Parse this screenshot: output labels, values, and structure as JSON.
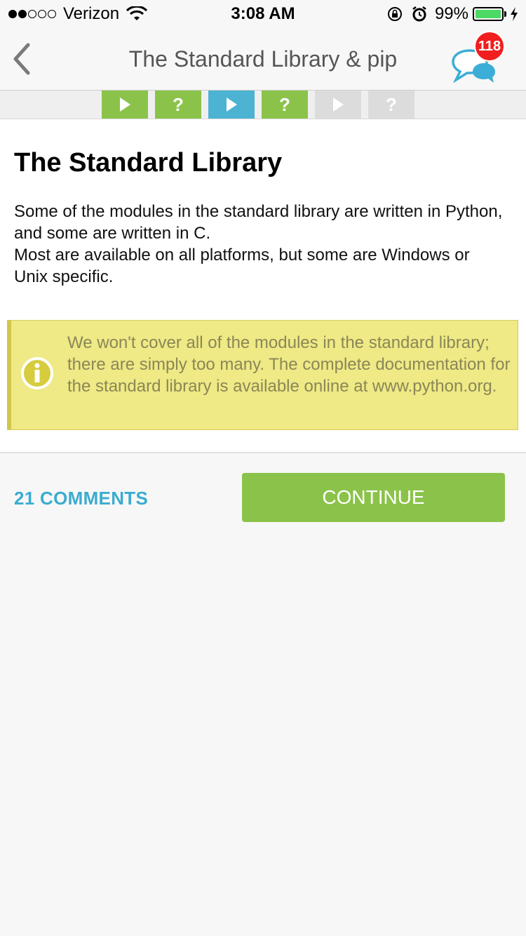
{
  "status_bar": {
    "carrier": "Verizon",
    "time": "3:08 AM",
    "battery_percent": "99%",
    "battery_level": 0.99,
    "signal_bars_filled": 2,
    "signal_bars_total": 5
  },
  "nav": {
    "title": "The Standard Library & pip",
    "notification_count": "118"
  },
  "steps": [
    {
      "kind": "play",
      "status": "completed"
    },
    {
      "kind": "quiz",
      "status": "completed",
      "label": "?"
    },
    {
      "kind": "play",
      "status": "current"
    },
    {
      "kind": "quiz",
      "status": "completed",
      "label": "?"
    },
    {
      "kind": "play",
      "status": "locked"
    },
    {
      "kind": "quiz",
      "status": "locked",
      "label": "?"
    }
  ],
  "lesson": {
    "title": "The Standard Library",
    "paragraph_1": "Some of the modules in the standard library are written in Python, and some are written in C.",
    "paragraph_2": "Most are available on all platforms, but some are Windows or Unix specific.",
    "info_text": "We won't cover all of the modules in the standard library; there are simply too many. The complete documentation for the standard library is available online at www.python.org."
  },
  "actions": {
    "comments_label": "21 COMMENTS",
    "continue_label": "CONTINUE"
  },
  "colors": {
    "step_completed": "#8bc34a",
    "step_current": "#4cb3d3",
    "step_locked": "#dcdcdc",
    "accent_blue": "#3bacd0",
    "continue_green": "#8bc34a",
    "info_background": "#efe986",
    "badge_red": "#f01e1e"
  }
}
